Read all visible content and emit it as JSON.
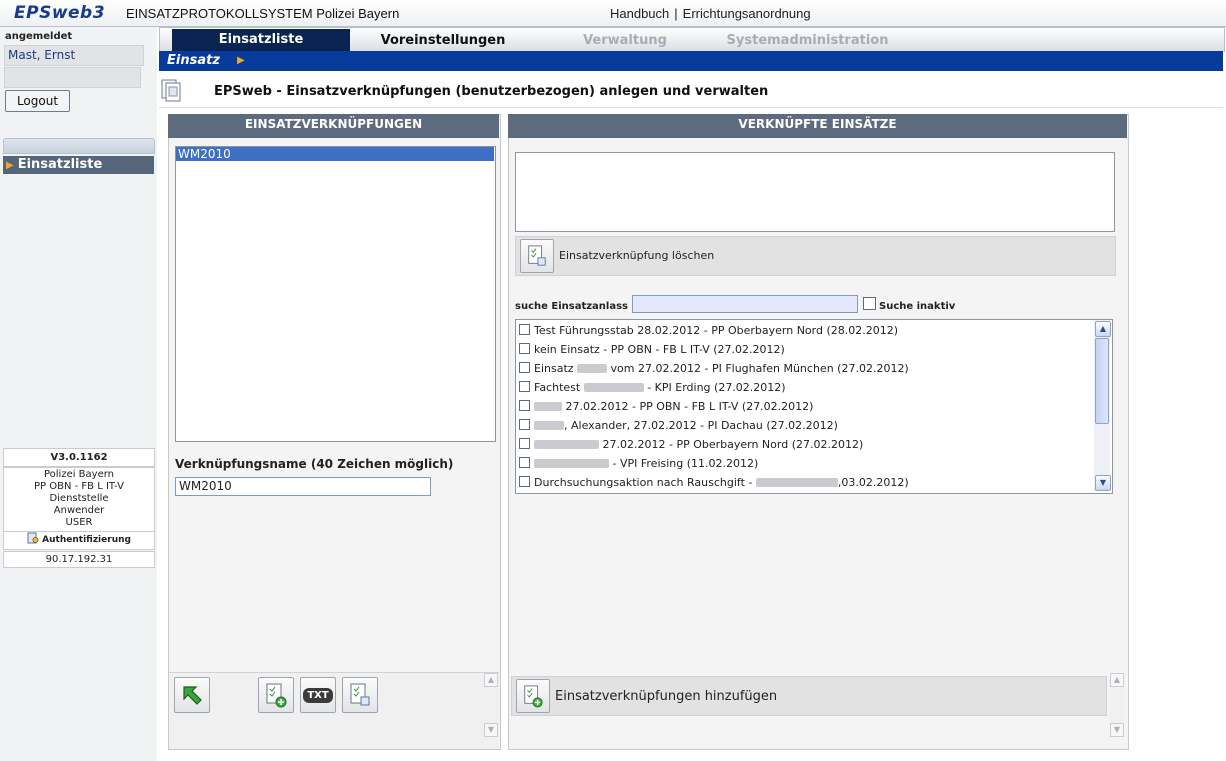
{
  "header": {
    "logo": "EPSweb3",
    "system_title": "EINSATZPROTOKOLLSYSTEM Polizei Bayern",
    "links": [
      "Handbuch",
      "Errichtungsanordnung"
    ],
    "link_separator": "|"
  },
  "sidebar": {
    "logged_in_label": "angemeldet",
    "user_name": "Mast, Ernst",
    "logout_label": "Logout",
    "nav_item": "Einsatzliste",
    "version": "V3.0.1162",
    "org_lines": [
      "Polizei Bayern",
      "PP OBN - FB L IT-V",
      "Dienststelle",
      "Anwender",
      "USER"
    ],
    "auth_label": "Authentifizierung",
    "ip": "90.17.192.31"
  },
  "tabs": [
    {
      "label": "Einsatzliste",
      "state": "active"
    },
    {
      "label": "Voreinstellungen",
      "state": "enabled"
    },
    {
      "label": "Verwaltung",
      "state": "disabled"
    },
    {
      "label": "Systemadministration",
      "state": "disabled"
    }
  ],
  "subbar": {
    "title": "Einsatz"
  },
  "page": {
    "title": "EPSweb - Einsatzverknüpfungen (benutzerbezogen) anlegen und verwalten"
  },
  "left_panel": {
    "header": "EINSATZVERKNÜPFUNGEN",
    "selected_item": "WM2010",
    "name_label": "Verknüpfungsname (40 Zeichen möglich)",
    "name_value": "WM2010",
    "txt_button": "TXT"
  },
  "right_panel": {
    "header": "VERKNÜPFTE EINSÄTZE",
    "delete_label": "Einsatzverknüpfung löschen",
    "search_label": "suche Einsatzanlass",
    "search_value": "",
    "inactive_label": "Suche inaktiv",
    "items": [
      {
        "pre": "Test Führungsstab 28.02.2012 - PP Oberbayern Nord (28.02.2012)",
        "post": ""
      },
      {
        "pre": "kein Einsatz - PP OBN - FB L IT-V (27.02.2012)",
        "post": ""
      },
      {
        "pre": "Einsatz",
        "post": "vom 27.02.2012 - PI Flughafen München (27.02.2012)"
      },
      {
        "pre": "Fachtest",
        "post": "- KPI Erding (27.02.2012)"
      },
      {
        "pre": "",
        "post": "27.02.2012 - PP OBN - FB L IT-V (27.02.2012)"
      },
      {
        "pre": "",
        "post": ", Alexander, 27.02.2012 - PI Dachau (27.02.2012)"
      },
      {
        "pre": "",
        "post": "27.02.2012 - PP Oberbayern Nord (27.02.2012)"
      },
      {
        "pre": "",
        "post": "- VPI Freising (11.02.2012)"
      },
      {
        "pre": "Durchsuchungsaktion nach Rauschgift -",
        "post": ",03.02.2012)"
      }
    ],
    "add_label": "Einsatzverknüpfungen hinzufügen"
  },
  "colors": {
    "nav_dark": "#0a2452",
    "subbar_blue": "#063b9b",
    "panel_header": "#5d6b7e",
    "selection": "#3d6fc4",
    "accent_orange": "#f5a623"
  }
}
